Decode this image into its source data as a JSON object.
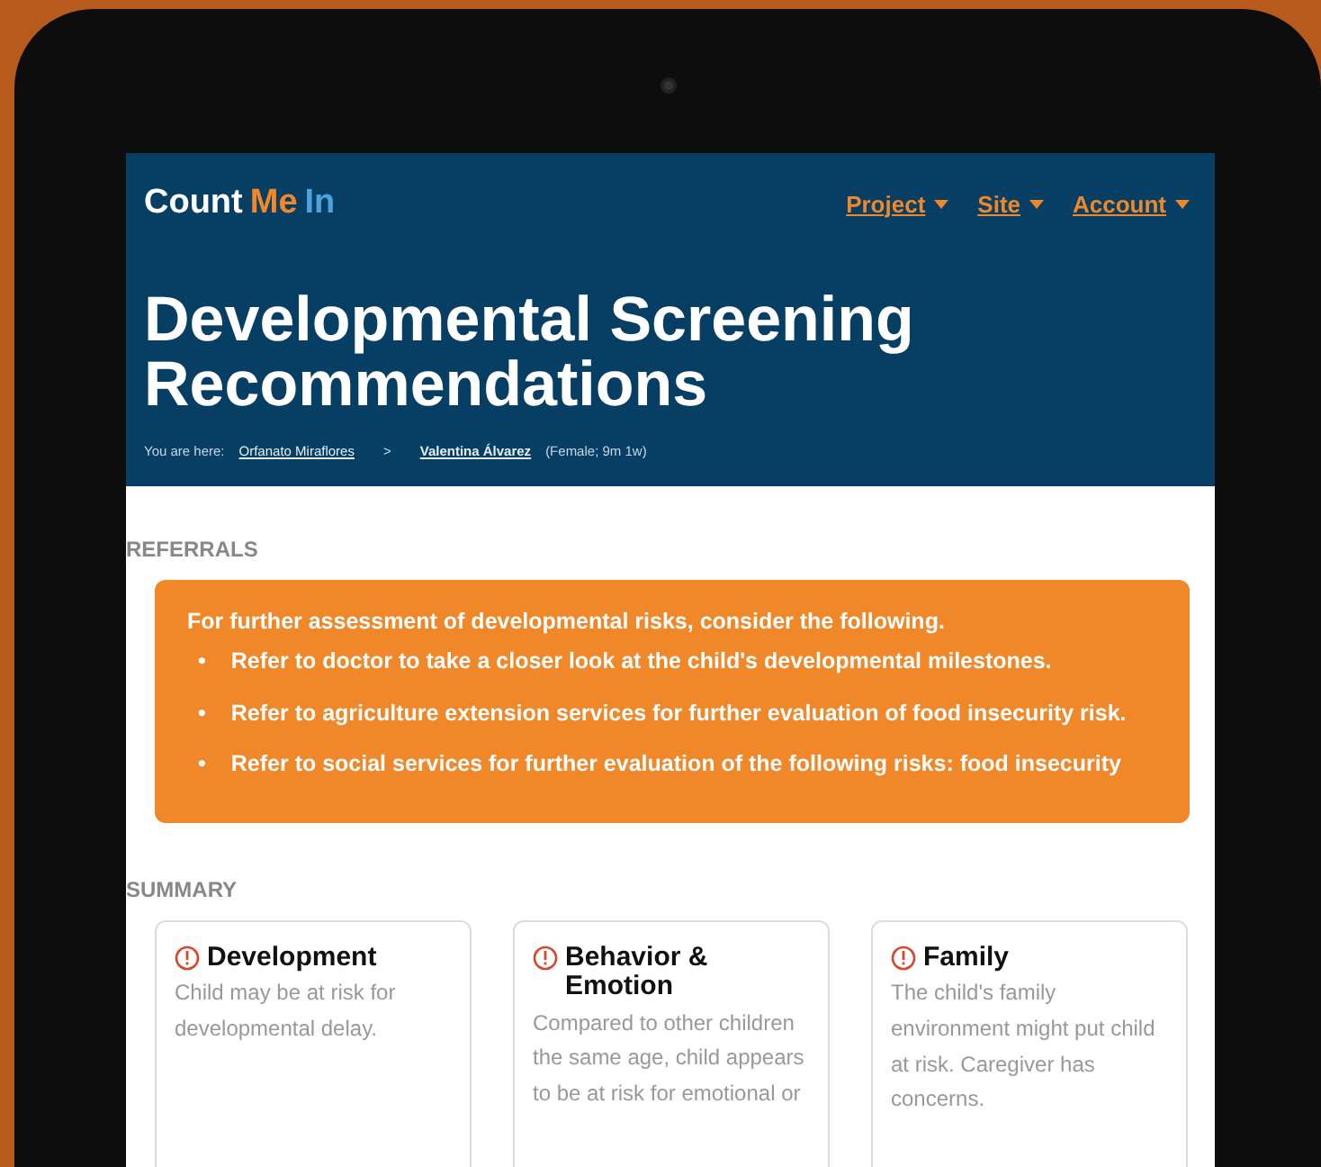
{
  "logo": [
    {
      "text": "Count",
      "color": "#ffffff"
    },
    {
      "text": "Me",
      "color": "#f0882a"
    },
    {
      "text": "In",
      "color": "#4aa3df"
    }
  ],
  "nav": [
    {
      "label": "Project"
    },
    {
      "label": "Site"
    },
    {
      "label": "Account"
    }
  ],
  "title": "Developmental Screening Recommendations",
  "breadcrumb": {
    "prefix": "You are here:",
    "items": [
      {
        "label": "Orfanato Miraflores",
        "bold": false
      },
      {
        "label": "Valentina Álvarez",
        "bold": true
      }
    ],
    "separator": ">",
    "detail": "(Female; 9m 1w)"
  },
  "referrals": {
    "heading": "REFERRALS",
    "bullet": "•",
    "intro": "For further assessment of developmental risks, consider the following.",
    "items": [
      "Refer to doctor to take a closer look at the child's developmental milestones.",
      "Refer to agriculture extension services for further evaluation of food insecurity risk.",
      "Refer to social services for further evaluation of the following risks: food insecurity"
    ]
  },
  "summary": {
    "heading": "SUMMARY",
    "cards": [
      {
        "title": "Development",
        "text": "Child may be at risk for developmental delay."
      },
      {
        "title": "Behavior & Emotion",
        "text": "Compared to other children the same age, child appears to be at risk for emotional or"
      },
      {
        "title": "Family",
        "text": "The child's family environment might put child at risk. Caregiver has concerns."
      }
    ]
  }
}
